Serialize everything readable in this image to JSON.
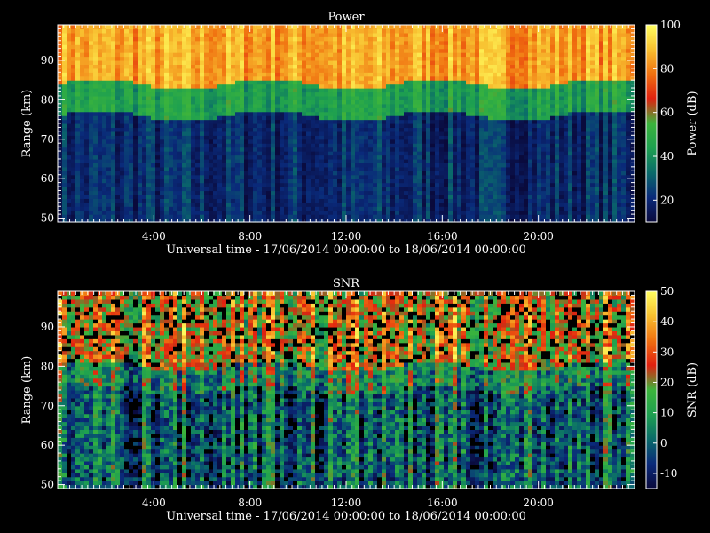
{
  "chart_data": [
    {
      "type": "heatmap",
      "title": "Power",
      "xlabel": "Universal time - 17/06/2014 00:00:00 to 18/06/2014 00:00:00",
      "ylabel": "Range (km)",
      "colorbar_label": "Power (dB)",
      "x_ticks": [
        "4:00",
        "8:00",
        "12:00",
        "16:00",
        "20:00"
      ],
      "x_tick_hours": [
        4,
        8,
        12,
        16,
        20
      ],
      "xlim_hours": [
        0,
        24
      ],
      "y_ticks": [
        50,
        60,
        70,
        80,
        90
      ],
      "ylim": [
        49,
        99
      ],
      "colorbar_ticks": [
        20,
        40,
        60,
        80,
        100
      ],
      "colorbar_range": [
        10,
        100
      ],
      "colormap": [
        "#0a0a3c",
        "#0a2a7a",
        "#0a6a6a",
        "#1ea050",
        "#3cb43c",
        "#e02010",
        "#f07010",
        "#f8c030",
        "#ffff60"
      ],
      "background": "#000000",
      "approx_structure": {
        "upper_layer_km": [
          84,
          99
        ],
        "upper_layer_dB": 85,
        "transition_km": [
          76,
          84
        ],
        "transition_dB": 45,
        "lower_layer_km": [
          49,
          76
        ],
        "lower_layer_dB": 20
      }
    },
    {
      "type": "heatmap",
      "title": "SNR",
      "xlabel": "Universal time - 17/06/2014 00:00:00 to 18/06/2014 00:00:00",
      "ylabel": "Range (km)",
      "colorbar_label": "SNR (dB)",
      "x_ticks": [
        "4:00",
        "8:00",
        "12:00",
        "16:00",
        "20:00"
      ],
      "x_tick_hours": [
        4,
        8,
        12,
        16,
        20
      ],
      "xlim_hours": [
        0,
        24
      ],
      "y_ticks": [
        50,
        60,
        70,
        80,
        90
      ],
      "ylim": [
        49,
        99
      ],
      "colorbar_ticks": [
        -10,
        0,
        10,
        20,
        30,
        40,
        50
      ],
      "colorbar_range": [
        -15,
        50
      ],
      "colormap": [
        "#0a0a3c",
        "#0a2a7a",
        "#0a6a6a",
        "#1ea050",
        "#3cb43c",
        "#e02010",
        "#f07010",
        "#f8c030",
        "#ffff60"
      ],
      "background": "#000000",
      "approx_structure": {
        "upper_layer_km": [
          80,
          99
        ],
        "upper_layer_dB": 25,
        "transition_km": [
          74,
          80
        ],
        "transition_dB": 10,
        "lower_layer_km": [
          49,
          74
        ],
        "lower_layer_dB": 0
      }
    }
  ]
}
